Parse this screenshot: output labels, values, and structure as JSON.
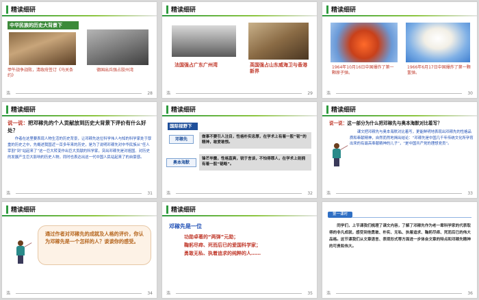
{
  "header_title": "精读细研",
  "footer_left": "浩",
  "slides": {
    "s28": {
      "number": "28",
      "band": "中华民族的历史大背景下",
      "cap1": "甲午战争战败，清政府签订《马关条约》",
      "cap2": "德国出兵强占胶州湾"
    },
    "s29": {
      "number": "29",
      "cap1": "法国强占广东广州湾",
      "cap2": "英国强占山东威海卫与香港新界"
    },
    "s30": {
      "number": "30",
      "cap1": "1964年10月16日中国爆炸了第一颗原子弹。",
      "cap2": "1966年6月17日中国爆炸了第一颗氢弹。"
    },
    "s31": {
      "number": "31",
      "q_prefix": "说一说：",
      "q_text": "把邓稼先的个人贡献放到历史大背景下评价有什么好处？",
      "answer": "作者在这里要表现人物生活的历史背景，让邓稼先这位科学伟人与知的科学家处于厚重的历史之中，先概述我国近一百多年来的历史，是为了说明邓稼先对中华民族从“任人宰割”到“站起来了”这一巨大转变作出巨大贡献的科学家，突出邓稼先是对祖国、对历史的发展产生巨大影响的历史人物，同时也表达出这一代中国人民站起来了的自豪感。"
    },
    "s32": {
      "number": "32",
      "band": "国际视野下",
      "label1": "邓稼先",
      "text1": "做事不要引人注目，性格朴实忠厚，在学术上有着一股“韧”的精神，敢爱敢恨。",
      "label2": "奥本海默",
      "text2": "锋芒毕露，性格直爽，锐于言谈，不怕得罪人，在学术上则拥有着一股“韬略”。"
    },
    "s33": {
      "number": "33",
      "q_prefix": "说一说：",
      "q_text": "这一部分为什么把邓稼先与奥本海默对比着写？",
      "answer": "课文把邓稼先与奥本海默对比着写，更能鲜明地表现出邓稼先的性格品质和奉献精神，自然而然地揭出结论：“邓稼先是中国几千年传统文化所孕育出来的有最高奉献精神的儿子”，“是中国共产党的理想党员”。"
    },
    "s34": {
      "number": "34",
      "bubble": "通过作者对邓稼先的成就及人格的评价，你认为邓稼先是一个怎样的人？谈谈你的感受。"
    },
    "s35": {
      "number": "35",
      "title": "邓稼先是一位",
      "l1": "功勋卓著的“两弹”元勋；",
      "l2": "鞠躬尽瘁、死而后已的爱国科学家；",
      "l3": "勇敢无私、执着追求的纯粹的人……"
    },
    "s36": {
      "number": "36",
      "tag": "第一课时",
      "text": "同学们，上节课我们梳理了课文内容，了解了邓稼先作为老一辈科学家的代表取得的非凡成就，感受到他勇敢、朴实、无私、执着追求、鞠躬尽瘁、死而后已的伟大品格。这节课我们从文章语言、表现形式等方面进一步体会文章的特点和邓稼先精神的可贵和伟大。"
    }
  }
}
